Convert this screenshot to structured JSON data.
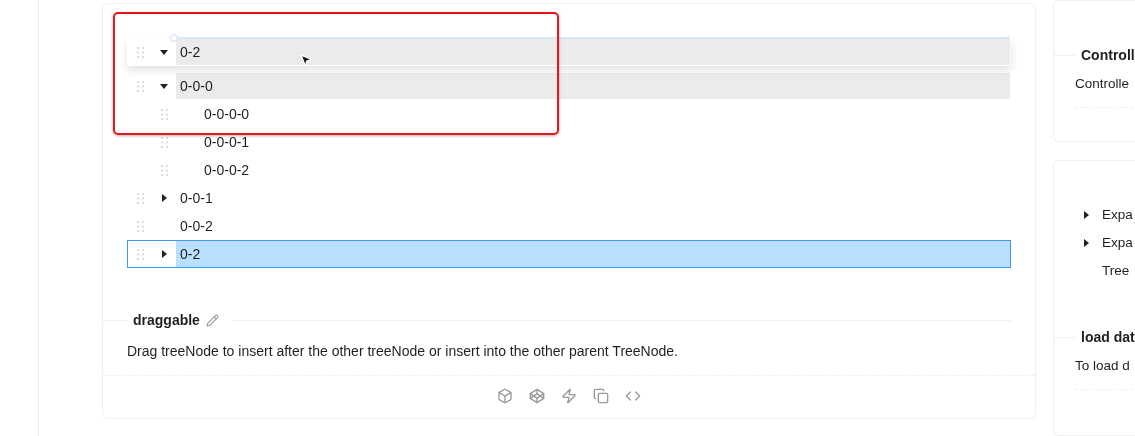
{
  "drag_preview": {
    "label": "0-2",
    "expanded": true
  },
  "tree": [
    {
      "children": [
        {
          "label": "0-0-0",
          "expanded": true,
          "hovered": true,
          "selected": false,
          "children": [
            {
              "label": "0-0-0-0",
              "selected": false
            },
            {
              "label": "0-0-0-1",
              "selected": false
            },
            {
              "label": "0-0-0-2",
              "selected": false
            }
          ]
        },
        {
          "label": "0-0-1",
          "expanded": false,
          "hovered": false,
          "selected": false
        },
        {
          "label": "0-0-2",
          "selected": false
        }
      ]
    },
    {
      "label": "0-2",
      "expanded": false,
      "selected": true
    }
  ],
  "demo": {
    "title": "draggable",
    "description": "Drag treeNode to insert after the other treeNode or insert into the other parent TreeNode."
  },
  "side_demo_1": {
    "title": "Controll",
    "description": "Controlle"
  },
  "side_demo_2": {
    "tree": [
      {
        "label": "Expa",
        "expanded": false
      },
      {
        "label": "Expa",
        "expanded": false
      },
      {
        "label": "Tree"
      }
    ],
    "title": "load dat",
    "description": "To load d"
  }
}
